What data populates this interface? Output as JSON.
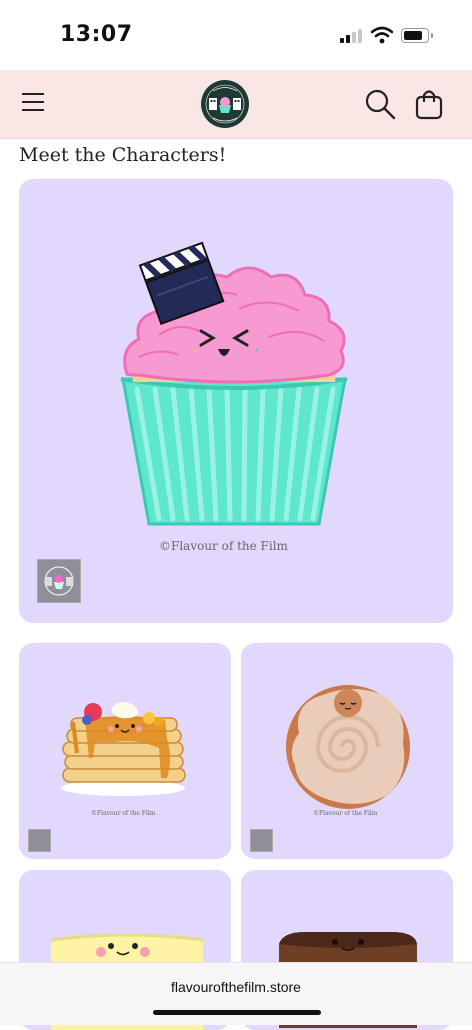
{
  "status_bar": {
    "time": "13:07"
  },
  "header": {
    "menu_icon": "hamburger-menu-icon",
    "logo_text": "FLAVOUR OF THE FILM",
    "search_icon": "search-icon",
    "cart_icon": "shopping-bag-icon"
  },
  "section": {
    "title": "Meet the Characters!"
  },
  "cards": [
    {
      "character": "cupcake",
      "copyright": "©Flavour of the Film",
      "color": "#e2d8fd"
    },
    {
      "character": "pancakes",
      "copyright": "©Flavour of the Film"
    },
    {
      "character": "cinnamon-roll",
      "copyright": "©Flavour of the Film"
    },
    {
      "character": "sponge-cake"
    },
    {
      "character": "brownie"
    }
  ],
  "browser": {
    "url": "flavourofthefilm.store"
  },
  "colors": {
    "header_bg": "#fbe6e6",
    "card_bg": "#e2d8fd",
    "accent_mint": "#5ee6cf",
    "frosting_pink": "#f79ad2"
  }
}
